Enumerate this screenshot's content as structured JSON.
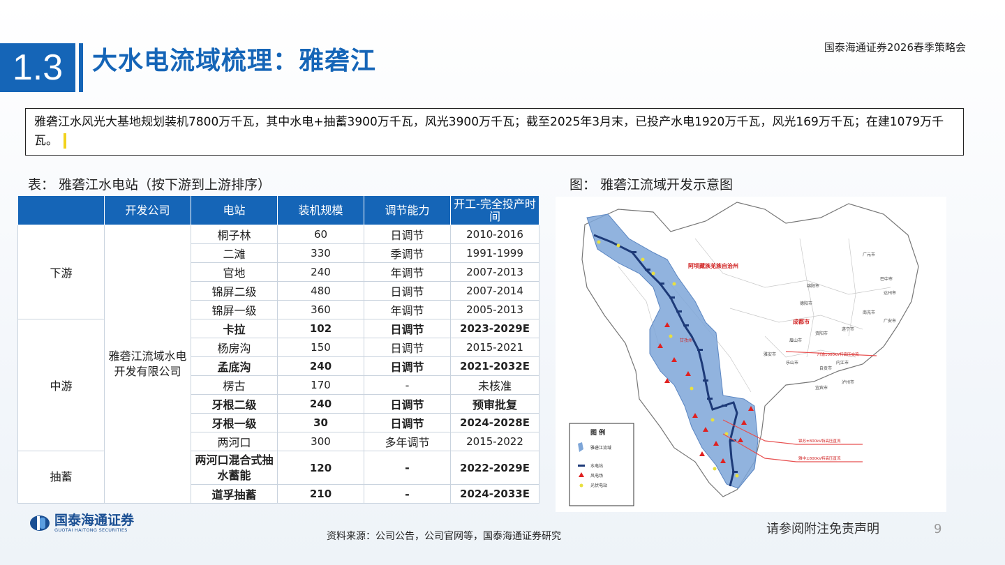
{
  "header": {
    "brand": "国泰海通证券2026春季策略会",
    "section_number": "1.3",
    "title": "大水电流域梳理：雅砻江"
  },
  "summary": "雅砻江水风光大基地规划装机7800万千瓦，其中水电+抽蓄3900万千瓦，风光3900万千瓦；截至2025年3月末，已投产水电1920万千瓦，风光169万千瓦；在建1079万千瓦。",
  "table": {
    "caption": "表： 雅砻江水电站（按下游到上游排序）",
    "headers": [
      "",
      "开发公司",
      "电站",
      "装机规模",
      "调节能力",
      "开工-完全投产时间"
    ],
    "company": "雅砻江流域水电开发有限公司",
    "regions": [
      {
        "name": "下游",
        "rows": [
          {
            "station": "桐子林",
            "capacity": "60",
            "regulation": "日调节",
            "period": "2010-2016",
            "bold": false
          },
          {
            "station": "二滩",
            "capacity": "330",
            "regulation": "季调节",
            "period": "1991-1999",
            "bold": false
          },
          {
            "station": "官地",
            "capacity": "240",
            "regulation": "年调节",
            "period": "2007-2013",
            "bold": false
          },
          {
            "station": "锦屏二级",
            "capacity": "480",
            "regulation": "日调节",
            "period": "2007-2014",
            "bold": false
          },
          {
            "station": "锦屏一级",
            "capacity": "360",
            "regulation": "年调节",
            "period": "2005-2013",
            "bold": false
          }
        ]
      },
      {
        "name": "中游",
        "rows": [
          {
            "station": "卡拉",
            "capacity": "102",
            "regulation": "日调节",
            "period": "2023-2029E",
            "bold": true
          },
          {
            "station": "杨房沟",
            "capacity": "150",
            "regulation": "日调节",
            "period": "2015-2021",
            "bold": false
          },
          {
            "station": "孟底沟",
            "capacity": "240",
            "regulation": "日调节",
            "period": "2021-2032E",
            "bold": true
          },
          {
            "station": "楞古",
            "capacity": "170",
            "regulation": "-",
            "period": "未核准",
            "bold": false
          },
          {
            "station": "牙根二级",
            "capacity": "240",
            "regulation": "日调节",
            "period": "预审批复",
            "bold": true
          },
          {
            "station": "牙根一级",
            "capacity": "30",
            "regulation": "日调节",
            "period": "2024-2028E",
            "bold": true
          },
          {
            "station": "两河口",
            "capacity": "300",
            "regulation": "多年调节",
            "period": "2015-2022",
            "bold": false
          }
        ]
      },
      {
        "name": "抽蓄",
        "rows": [
          {
            "station": "两河口混合式抽水蓄能",
            "capacity": "120",
            "regulation": "-",
            "period": "2022-2029E",
            "bold": true
          },
          {
            "station": "道孚抽蓄",
            "capacity": "210",
            "regulation": "-",
            "period": "2024-2033E",
            "bold": true
          }
        ]
      }
    ]
  },
  "map": {
    "caption": "图： 雅砻江流域开发示意图",
    "legend_title": "图 例",
    "legend_items": [
      "雅砻江流域",
      "水电站",
      "风电场",
      "光伏电站"
    ],
    "labels": {
      "prefecture": "阿坝藏族羌族自治州",
      "chengdu": "成都市",
      "line1": "川渝1000kV特高压交流",
      "line2": "锦苏±800kV特高压直流",
      "line3": "雅中±800kV特高压直流",
      "c_guangyuan": "广元市",
      "c_bazhong": "巴中市",
      "c_mianyang": "绵阳市",
      "c_dazhou": "达州市",
      "c_deyang": "德阳市",
      "c_nanchong": "南充市",
      "c_guangan": "广安市",
      "c_meishan": "眉山市",
      "c_ziyang": "资阳市",
      "c_suining": "遂宁市",
      "c_neijiang": "内江市",
      "c_yaan": "雅安市",
      "c_leshan": "乐山市",
      "c_zigong": "自贡市",
      "c_yibin": "宜宾市",
      "c_luzhou": "泸州市",
      "c_ganzi": "甘孜州"
    },
    "colors": {
      "basin": "#7ea6d8",
      "river": "#1d3a78",
      "wind": "#e02020",
      "solar": "#e8e040",
      "line": "#e85050"
    }
  },
  "footer": {
    "logo_cn": "国泰海通证券",
    "logo_en": "GUOTAI HAITONG SECURITIES",
    "source": "资料来源：公司公告，公司官网等，国泰海通证券研究",
    "disclaimer": "请参阅附注免责声明",
    "page": "9"
  }
}
